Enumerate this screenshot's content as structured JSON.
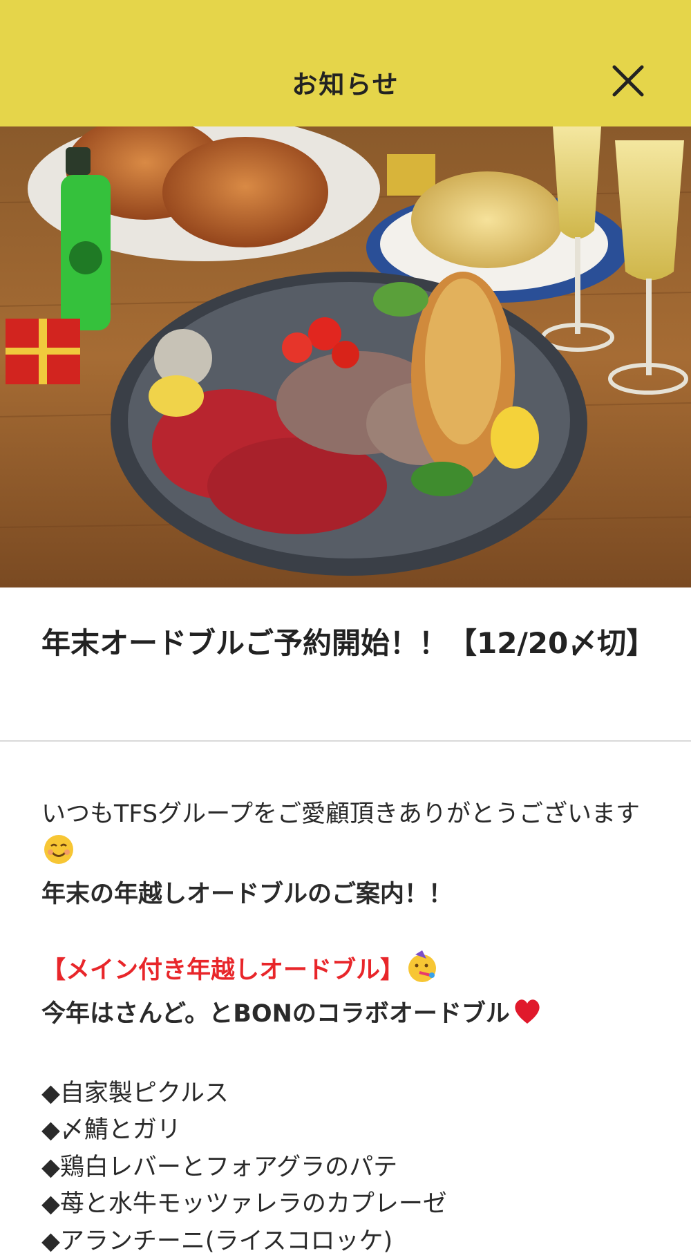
{
  "header": {
    "title": "お知らせ",
    "close_icon": "close-icon"
  },
  "hero": {
    "icon": "food-photo"
  },
  "article": {
    "title": "年末オードブルご予約開始！！【12/20〆切】",
    "body": {
      "line1": "いつもTFSグループをご愛顧頂きありがとうございます",
      "line2": "年末の年越しオードブルのご案内！！",
      "line3": "【メイン付き年越しオードブル】",
      "line4": "今年はさんど。とBONのコラボオードブル",
      "items": [
        "◆自家製ピクルス",
        "◆〆鯖とガリ",
        "◆鶏白レバーとフォアグラのパテ",
        "◆苺と水牛モッツァレラのカプレーゼ",
        "◆アランチーニ(ライスコロッケ)"
      ]
    }
  },
  "colors": {
    "header_bg": "#e5d54a",
    "accent_red": "#e8262a"
  }
}
